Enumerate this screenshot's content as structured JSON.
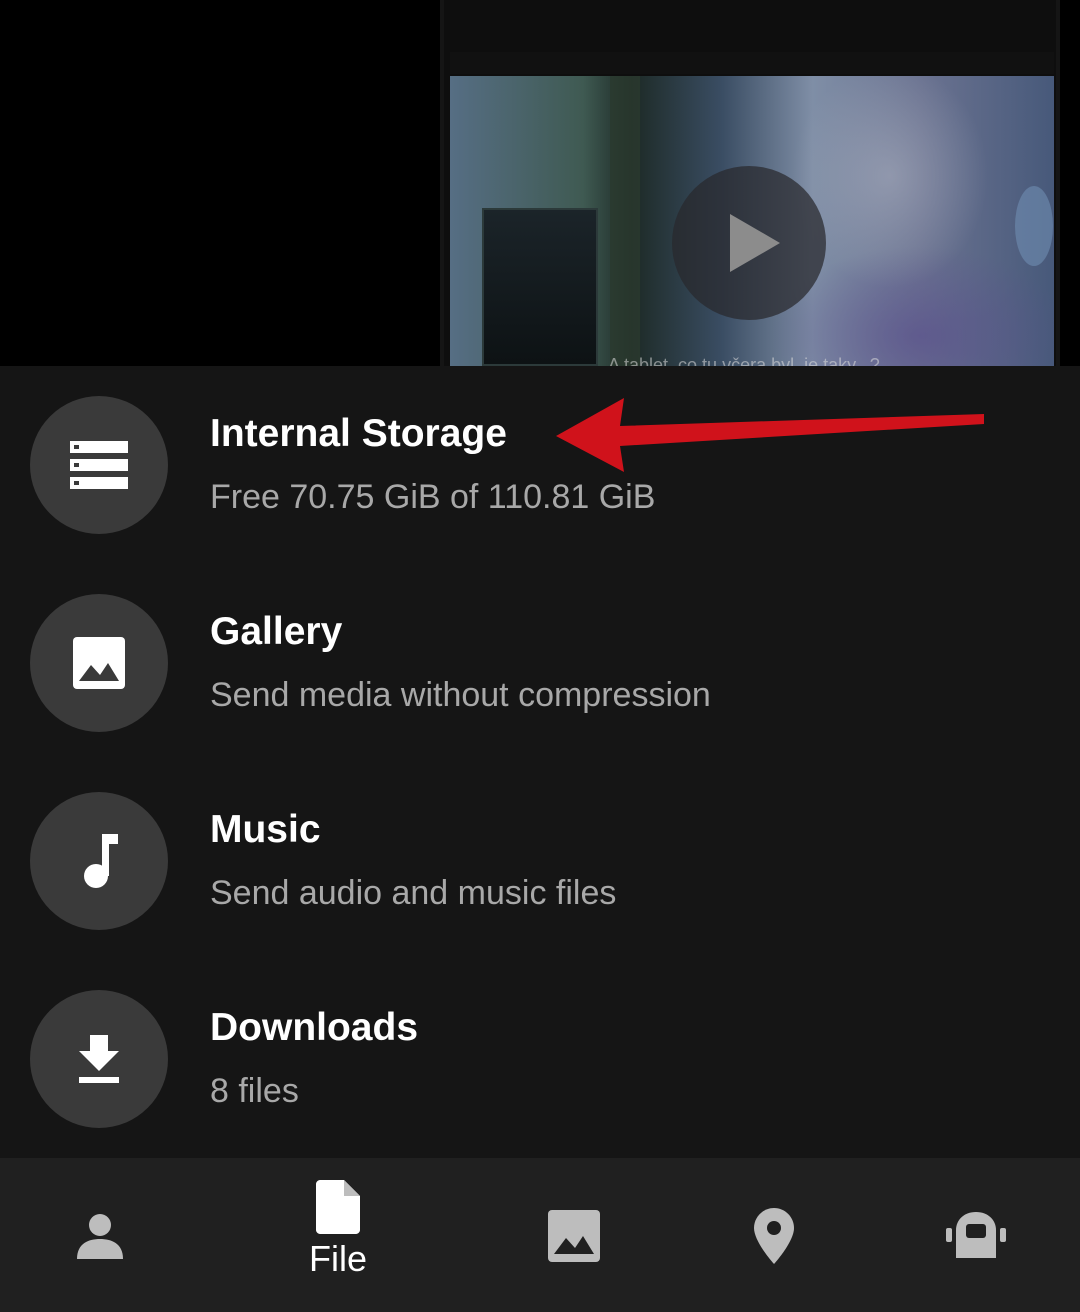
{
  "video": {
    "caption": "A tablet, co tu včera byl, je taky...?"
  },
  "attach_menu": {
    "items": [
      {
        "title": "Internal Storage",
        "subtitle": "Free 70.75 GiB of 110.81 GiB",
        "icon": "storage-icon"
      },
      {
        "title": "Gallery",
        "subtitle": "Send media without compression",
        "icon": "image-icon"
      },
      {
        "title": "Music",
        "subtitle": "Send audio and music files",
        "icon": "music-note-icon"
      },
      {
        "title": "Downloads",
        "subtitle": "8 files",
        "icon": "download-icon"
      }
    ]
  },
  "annotation": {
    "color": "#d0121b",
    "icon": "red-arrow"
  },
  "tabbar": {
    "tabs": [
      {
        "icon": "person-icon",
        "label": ""
      },
      {
        "icon": "file-icon",
        "label": "File",
        "active": true
      },
      {
        "icon": "gallery-icon",
        "label": ""
      },
      {
        "icon": "location-pin-icon",
        "label": ""
      },
      {
        "icon": "poll-robot-icon",
        "label": ""
      }
    ]
  },
  "colors": {
    "sheet_background": "#151515",
    "icon_circle": "#3a3a3a",
    "tabbar_background": "#202020",
    "subtitle_text": "#a8a8a8"
  }
}
